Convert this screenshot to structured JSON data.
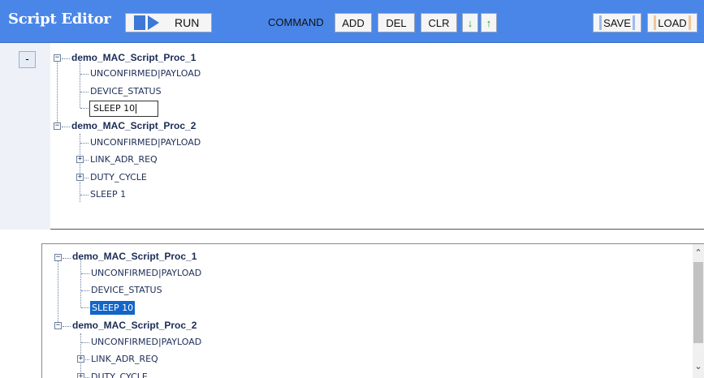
{
  "toolbar": {
    "title": "Script Editor",
    "run_label": "RUN",
    "command_label": "COMMAND",
    "add_label": "ADD",
    "del_label": "DEL",
    "clr_label": "CLR",
    "down_label": "↓",
    "up_label": "↑",
    "save_label": "SAVE",
    "load_label": "LOAD"
  },
  "collapse_label": "-",
  "tree_top": {
    "proc1": "demo_MAC_Script_Proc_1",
    "proc1_items": [
      "UNCONFIRMED|PAYLOAD",
      "DEVICE_STATUS"
    ],
    "proc1_editing": "SLEEP 10",
    "proc2": "demo_MAC_Script_Proc_2",
    "proc2_items": [
      "UNCONFIRMED|PAYLOAD",
      "LINK_ADR_REQ",
      "DUTY_CYCLE",
      "SLEEP 1"
    ]
  },
  "tree_bottom": {
    "proc1": "demo_MAC_Script_Proc_1",
    "proc1_items": [
      "UNCONFIRMED|PAYLOAD",
      "DEVICE_STATUS"
    ],
    "proc1_selected": "SLEEP 10",
    "proc2": "demo_MAC_Script_Proc_2",
    "proc2_items": [
      "UNCONFIRMED|PAYLOAD",
      "LINK_ADR_REQ",
      "DUTY_CYCLE"
    ]
  },
  "expander_minus": "−",
  "expander_plus": "+",
  "colors": {
    "toolbar_bg": "#4a86e8",
    "selection": "#1265c9"
  }
}
